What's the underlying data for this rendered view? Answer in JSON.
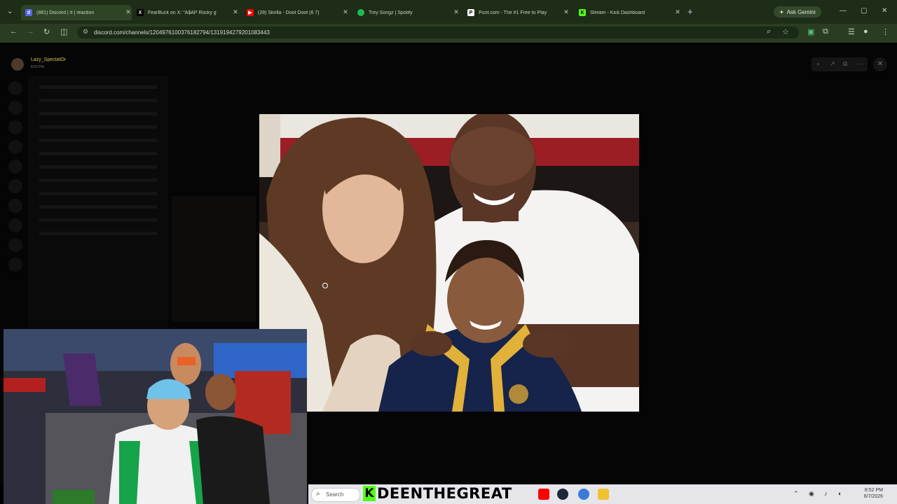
{
  "browser": {
    "tabs": [
      {
        "title": "(881) Discord | # | reaction",
        "fav": "D",
        "color": "#5865f2"
      },
      {
        "title": "FearBuck on X: \"A$AP Rocky g",
        "fav": "X",
        "color": "#000000"
      },
      {
        "title": "(28) Skrilla - Doot Doot (6 7)",
        "fav": "▶",
        "color": "#ff0000"
      },
      {
        "title": "Trey Songz | Spotify",
        "fav": "●",
        "color": "#1db954"
      },
      {
        "title": "Punt.com - The #1 Free to Play",
        "fav": "P",
        "color": "#ffffff"
      },
      {
        "title": "Stream - Kick Dashboard",
        "fav": "K",
        "color": "#53fc18"
      }
    ],
    "ask_gemini": "Ask Gemini",
    "url": "discord.com/channels/1204976100376182794/1319194279201083443"
  },
  "viewer": {
    "username": "Lazy_SpectatOr",
    "time": "8:52 PM"
  },
  "taskbar": {
    "search_placeholder": "Search",
    "kick_letter": "K",
    "brand_text": "DEENTHEGREAT",
    "time": "8:52 PM",
    "date": "6/7/2026"
  },
  "colors": {
    "kick_green": "#53fc18",
    "chrome_bg": "#1d2d17"
  }
}
